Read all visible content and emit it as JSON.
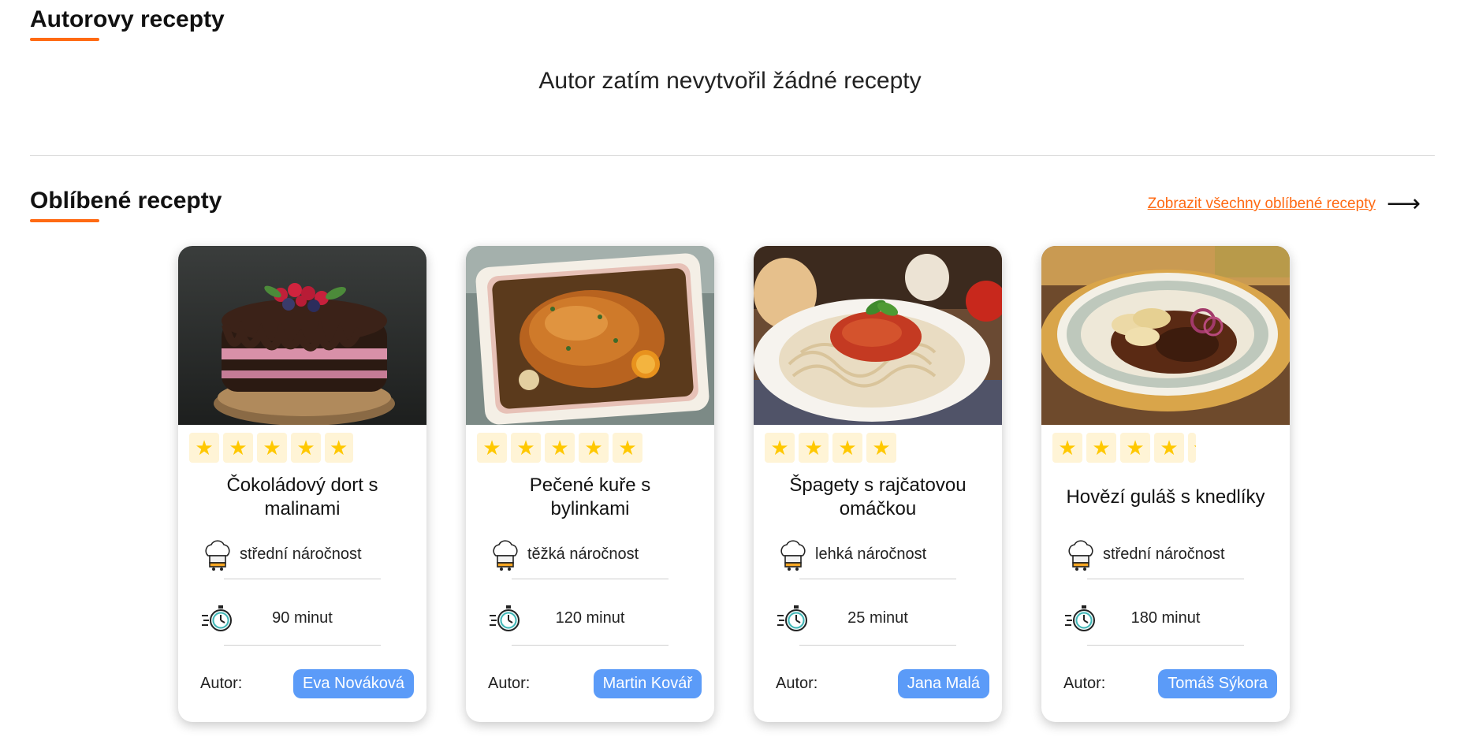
{
  "sections": {
    "author_recipes": {
      "title": "Autorovy recepty",
      "empty_message": "Autor zatím nevytvořil žádné recepty"
    },
    "favorites": {
      "title": "Oblíbené recepty",
      "show_all_label": "Zobrazit všechny oblíbené recepty",
      "show_all_icon": "arrow-right-icon"
    }
  },
  "colors": {
    "accent": "#ff6a13",
    "author_badge": "#5b9bf8",
    "star": "#ffc800",
    "star_bg": "#fff4d6"
  },
  "author_label": "Autor:",
  "cards": [
    {
      "name": "Čokoládový dort s malinami",
      "rating": 4.8,
      "difficulty": "střední náročnost",
      "time": "90 minut",
      "author": "Eva Nováková",
      "image": "chocolate-cake-photo"
    },
    {
      "name": "Pečené kuře s bylinkami",
      "rating": 5,
      "difficulty": "těžká náročnost",
      "time": "120 minut",
      "author": "Martin Kovář",
      "image": "roast-chicken-photo"
    },
    {
      "name": "Špagety s rajčatovou omáčkou",
      "rating": 4,
      "difficulty": "lehká náročnost",
      "time": "25 minut",
      "author": "Jana Malá",
      "image": "spaghetti-photo"
    },
    {
      "name": "Hovězí guláš s knedlíky",
      "rating": 4.1,
      "difficulty": "střední náročnost",
      "time": "180 minut",
      "author": "Tomáš Sýkora",
      "image": "goulash-photo"
    }
  ]
}
